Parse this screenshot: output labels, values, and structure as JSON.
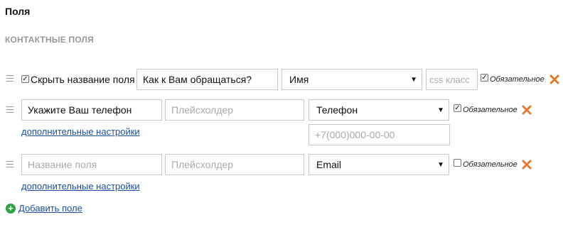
{
  "page": {
    "title": "Поля",
    "section": "КОНТАКТНЫЕ ПОЛЯ"
  },
  "rows": [
    {
      "hide_name_checkbox_label": "Скрыть название поля",
      "name_value": "Как к Вам обращаться?",
      "type_selected": "Имя",
      "css_placeholder": "css класс",
      "required_label": "Обязательное",
      "required_checked": true
    },
    {
      "name_value": "Укажите Ваш телефон",
      "placeholder_placeholder": "Плейсхолдер",
      "type_selected": "Телефон",
      "required_label": "Обязательное",
      "required_checked": true,
      "mask_placeholder": "+7(000)000-00-00",
      "more_settings": "дополнительные настройки"
    },
    {
      "name_placeholder": "Название поля",
      "placeholder_placeholder": "Плейсхолдер",
      "type_selected": "Email",
      "required_label": "Обязательное",
      "required_checked": false,
      "more_settings": "дополнительные настройки"
    }
  ],
  "add_field": "Добавить поле",
  "icons": {
    "drag": "drag-handle-icon",
    "remove": "close-icon",
    "add": "plus-circle-icon",
    "dropdown": "chevron-down-icon"
  },
  "colors": {
    "remove": "#e8772e",
    "add": "#2ea43c",
    "link": "#1a4fa0",
    "section": "#999999"
  }
}
